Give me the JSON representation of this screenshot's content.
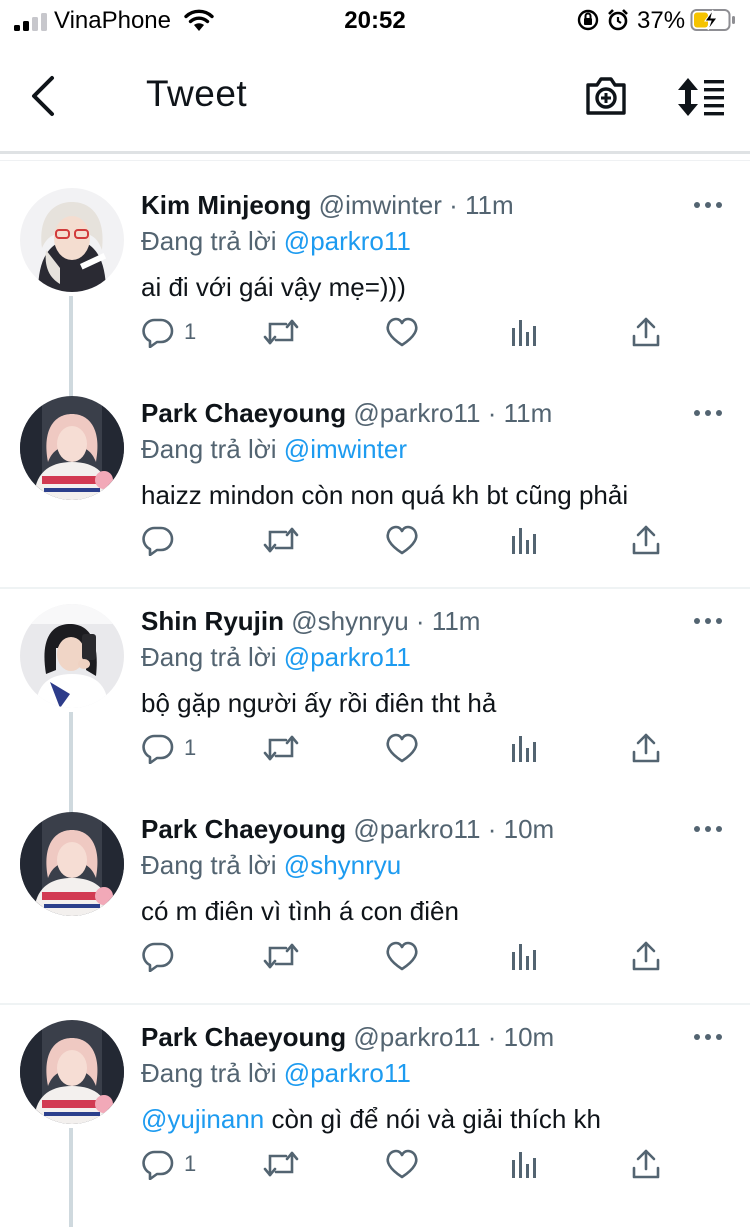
{
  "status_bar": {
    "carrier": "VinaPhone",
    "time": "20:52",
    "battery_percent": "37%",
    "signal_bars_active": 2,
    "signal_bars_total": 4
  },
  "header": {
    "title": "Tweet",
    "back_icon": "chevron-left-icon",
    "camera_icon": "camera-add-icon",
    "sort_icon": "sort-icon"
  },
  "colors": {
    "accent": "#1d9bf0",
    "text": "#0f1419",
    "secondary": "#536471",
    "divider": "#eff3f4"
  },
  "tweets": [
    {
      "name": "Kim Minjeong",
      "handle": "@imwinter",
      "separator": "·",
      "time": "11m",
      "reply_prefix": "Đang trả lời",
      "reply_to": "@parkro11",
      "text_mention": "",
      "text": "ai đi với gái vậy mẹ=)))",
      "reply_count": "1",
      "retweet_count": "",
      "like_count": ""
    },
    {
      "name": "Park Chaeyoung",
      "handle": "@parkro11",
      "separator": "·",
      "time": "11m",
      "reply_prefix": "Đang trả lời",
      "reply_to": "@imwinter",
      "text_mention": "",
      "text": "haizz mindon còn non quá kh bt cũng phải",
      "reply_count": "",
      "retweet_count": "",
      "like_count": ""
    },
    {
      "name": "Shin Ryujin",
      "handle": "@shynryu",
      "separator": "·",
      "time": "11m",
      "reply_prefix": "Đang trả lời",
      "reply_to": "@parkro11",
      "text_mention": "",
      "text": "bộ gặp người ấy rồi điên tht hả",
      "reply_count": "1",
      "retweet_count": "",
      "like_count": ""
    },
    {
      "name": "Park Chaeyoung",
      "handle": "@parkro11",
      "separator": "·",
      "time": "10m",
      "reply_prefix": "Đang trả lời",
      "reply_to": "@shynryu",
      "text_mention": "",
      "text": "có m điên vì tình á con điên",
      "reply_count": "",
      "retweet_count": "",
      "like_count": ""
    },
    {
      "name": "Park Chaeyoung",
      "handle": "@parkro11",
      "separator": "·",
      "time": "10m",
      "reply_prefix": "Đang trả lời",
      "reply_to": "@parkro11",
      "text_mention": "@yujinann",
      "text": " còn gì để nói và giải thích kh",
      "reply_count": "1",
      "retweet_count": "",
      "like_count": ""
    }
  ]
}
